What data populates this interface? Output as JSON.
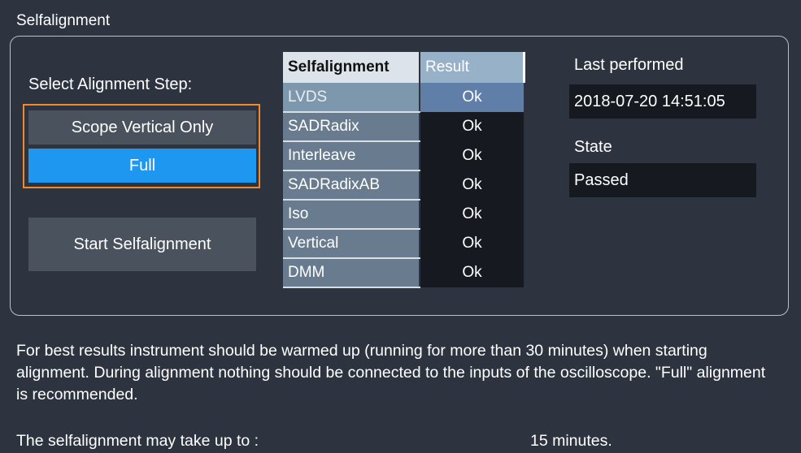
{
  "tab": {
    "title": "Selfalignment"
  },
  "step_selector": {
    "label": "Select Alignment Step:",
    "options": [
      "Scope Vertical Only",
      "Full"
    ],
    "selected": "Full"
  },
  "start_button": {
    "label": "Start Selfalignment"
  },
  "results_table": {
    "headers": [
      "Selfalignment",
      "Result"
    ],
    "rows": [
      {
        "name": "LVDS",
        "result": "Ok"
      },
      {
        "name": "SADRadix",
        "result": "Ok"
      },
      {
        "name": "Interleave",
        "result": "Ok"
      },
      {
        "name": "SADRadixAB",
        "result": "Ok"
      },
      {
        "name": "Iso",
        "result": "Ok"
      },
      {
        "name": "Vertical",
        "result": "Ok"
      },
      {
        "name": "DMM",
        "result": "Ok"
      }
    ]
  },
  "last_performed": {
    "label": "Last performed",
    "value": "2018-07-20 14:51:05"
  },
  "state": {
    "label": "State",
    "value": "Passed"
  },
  "info": {
    "text": "For best results instrument should be warmed up (running for more than 30 minutes) when starting alignment. During alignment nothing should be connected to the inputs of the oscilloscope. \"Full\" alignment is recommended.",
    "duration_label": "The selfalignment may take up to :",
    "duration_value": "15 minutes."
  },
  "colors": {
    "background": "#2d3440",
    "accent_blue": "#1e97f0",
    "highlight_orange": "#f08a2a",
    "button_gray": "#4a525d"
  }
}
